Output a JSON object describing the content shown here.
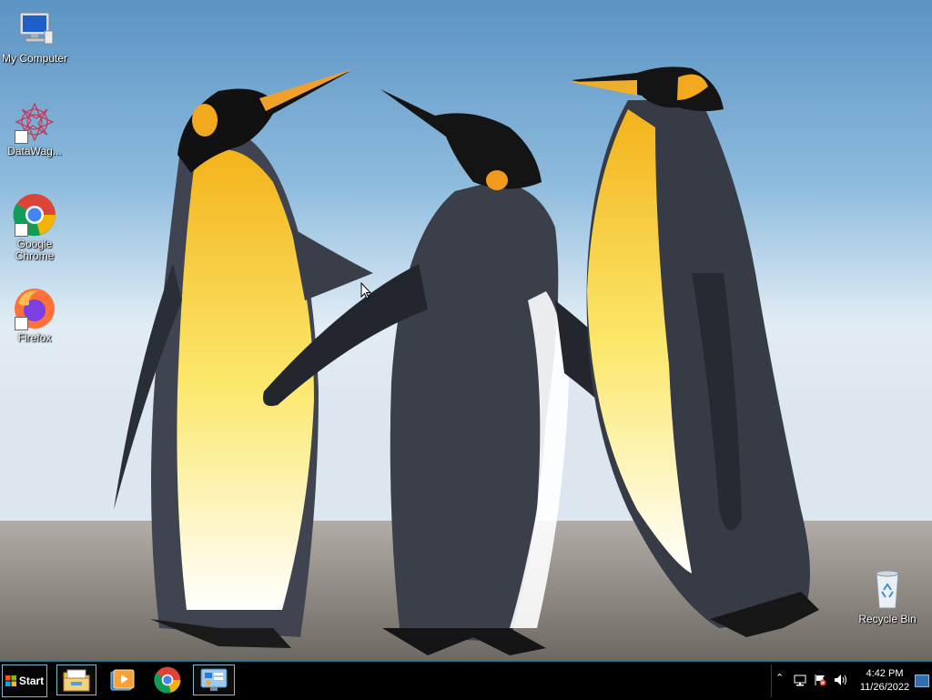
{
  "desktop": {
    "icons": [
      {
        "label": "My Computer",
        "icon": "computer-icon"
      },
      {
        "label": "DataWag...",
        "icon": "datawagon-icon"
      },
      {
        "label": "Google Chrome",
        "icon": "chrome-icon"
      },
      {
        "label": "Firefox",
        "icon": "firefox-icon"
      },
      {
        "label": "Recycle Bin",
        "icon": "recycle-bin-icon"
      }
    ]
  },
  "taskbar": {
    "start_label": "Start",
    "pinned": [
      "file-explorer-icon",
      "media-player-icon",
      "chrome-icon",
      "control-panel-icon"
    ],
    "tray": {
      "time": "4:42 PM",
      "date": "11/26/2022"
    }
  }
}
